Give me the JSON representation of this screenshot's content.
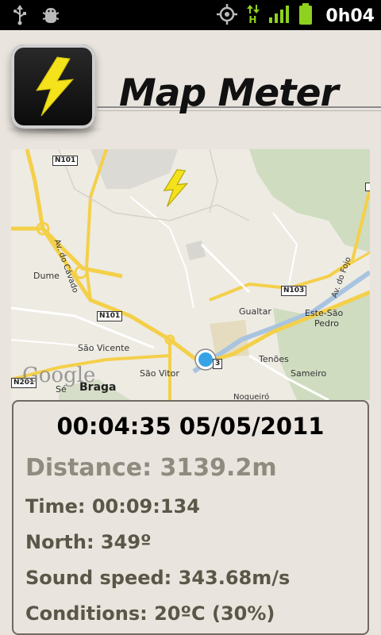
{
  "status_bar": {
    "time": "0h04",
    "icons": [
      "usb-icon",
      "debug-icon",
      "gps-icon",
      "data-transfer-icon",
      "signal-icon",
      "battery-icon"
    ],
    "data_type": "H"
  },
  "header": {
    "title": "Map Meter"
  },
  "map": {
    "labels": {
      "dume": "Dume",
      "sao_vicente": "São Vicente",
      "sao_vitor": "São Vitor",
      "braga": "Braga",
      "se": "Sé",
      "gualtar": "Gualtar",
      "este_sao_pedro_1": "Este-São",
      "este_sao_pedro_2": "Pedro",
      "tenoes": "Tenões",
      "sameiro": "Sameiro",
      "nogueiro": "Nogueiró",
      "av_cavado": "Av. do Cávado",
      "av_fojo": "Av. do Fojo"
    },
    "shields": {
      "n101_top": "N101",
      "n101_mid": "N101",
      "n103": "N103",
      "n201": "N201",
      "n3": "3"
    },
    "google": "Google"
  },
  "panel": {
    "datetime": "00:04:35 05/05/2011",
    "distance": "Distance: 3139.2m",
    "time": "Time: 00:09:134",
    "north": "North: 349º",
    "sound_speed": "Sound speed: 343.68m/s",
    "conditions": "Conditions: 20ºC (30%)"
  },
  "colors": {
    "background": "#e9e4dd",
    "status_bar": "#000000",
    "accent_green": "#8fd11f",
    "bolt_yellow": "#f4e21a",
    "distance_text": "#8f8b7f",
    "info_text": "#5b5748"
  }
}
